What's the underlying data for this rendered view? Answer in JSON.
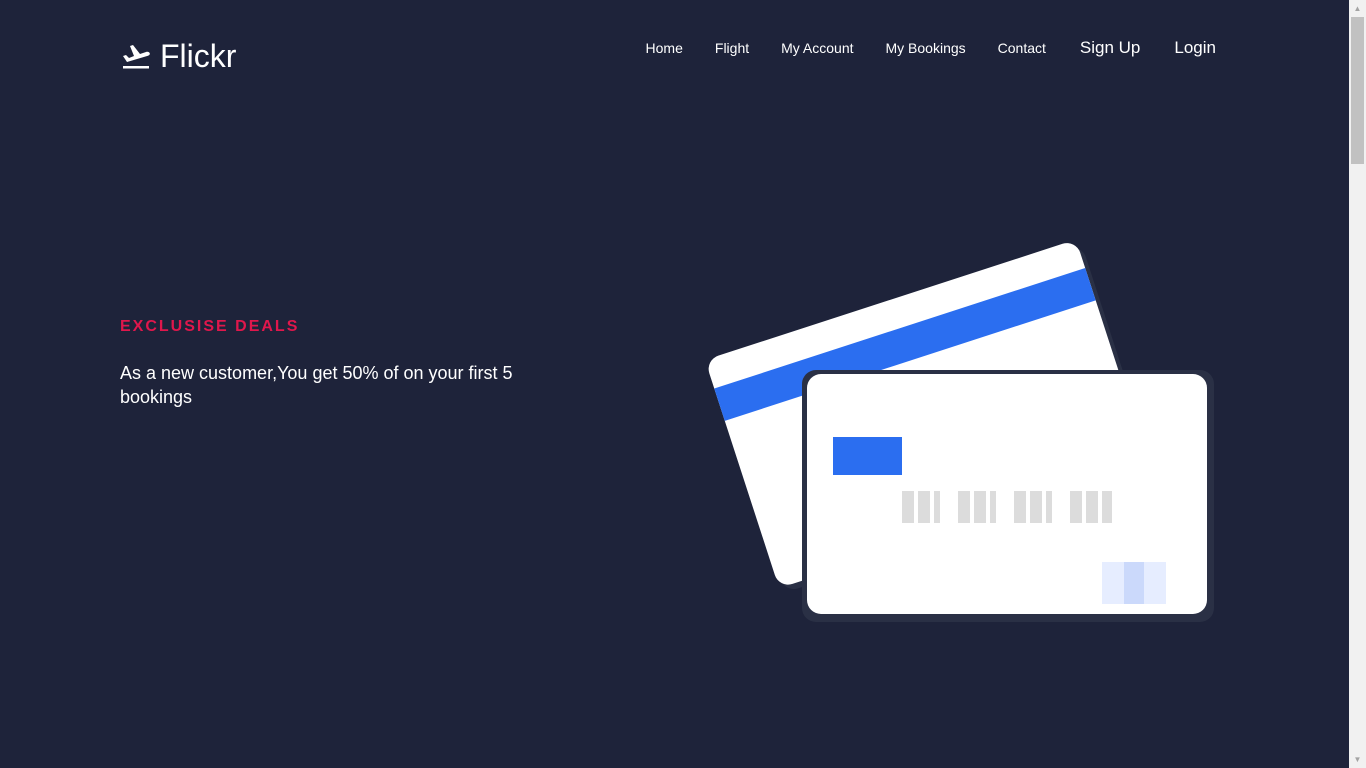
{
  "brand": {
    "name": "Flickr",
    "icon": "airplane-takeoff-icon"
  },
  "nav": {
    "items": [
      {
        "label": "Home"
      },
      {
        "label": "Flight"
      },
      {
        "label": "My Account"
      },
      {
        "label": "My Bookings"
      },
      {
        "label": "Contact"
      },
      {
        "label": "Sign Up"
      },
      {
        "label": "Login"
      }
    ]
  },
  "hero": {
    "label": "EXCLUSISE DEALS",
    "text": "As a new customer,You get 50% of on your first 5 bookings",
    "illustration": "credit-cards-illustration"
  },
  "colors": {
    "background": "#1e233a",
    "accent": "#e0174c",
    "card_blue": "#2b6ef0"
  }
}
